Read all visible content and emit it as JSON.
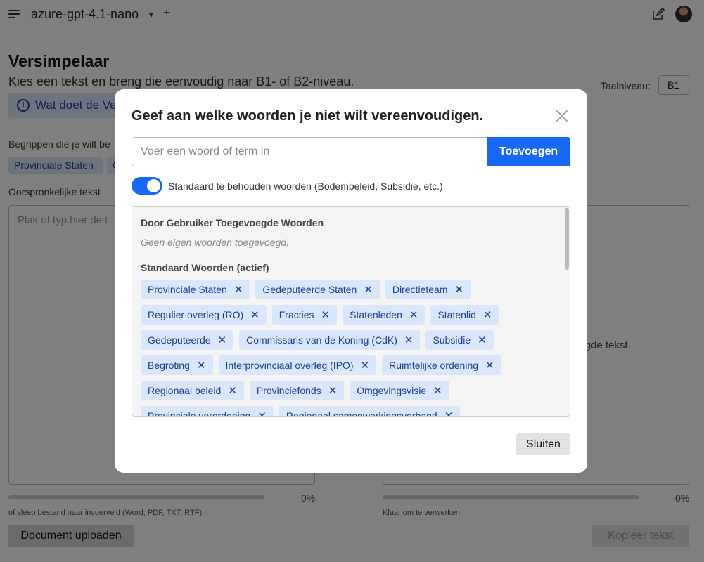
{
  "header": {
    "model_name": "azure-gpt-4.1-nano",
    "chevron_glyph": "⌄",
    "plus_glyph": "+"
  },
  "page": {
    "title": "Versimpelaar",
    "subtitle": "Kies een tekst en breng die eenvoudig naar B1- of B2-niveau.",
    "info_text": "Wat doet de Ve",
    "level_label": "Taalniveau:",
    "level_value": "B1",
    "terms_label": "Begrippen die je wilt be",
    "term_chips": [
      "Provinciale Staten",
      "G"
    ],
    "original_label": "Oorspronkelijke tekst",
    "original_placeholder": "Plak of typ hier de t",
    "result_text": "digde tekst.",
    "left_percent": "0%",
    "right_percent": "0%",
    "left_hint": "of sleep bestand naar invoerveld (Word, PDF, TXT, RTF)",
    "right_hint": "Klaar om te verwerken",
    "upload_button": "Document uploaden",
    "copy_button": "Kopieer tekst"
  },
  "modal": {
    "title": "Geef aan welke woorden je niet wilt vereenvoudigen.",
    "input_placeholder": "Voer een woord of term in",
    "input_value": "",
    "add_button": "Toevoegen",
    "toggle_on": true,
    "toggle_label": "Standaard te behouden woorden (Bodembeleid, Subsidie, etc.)",
    "user_words_heading": "Door Gebruiker Toegevoegde Woorden",
    "user_words_empty": "Geen eigen woorden toegevoegd.",
    "default_words_heading": "Standaard Woorden (actief)",
    "default_words": [
      "Provinciale Staten",
      "Gedeputeerde Staten",
      "Directieteam",
      "Regulier overleg (RO)",
      "Fracties",
      "Statenleden",
      "Statenlid",
      "Gedeputeerde",
      "Commissaris van de Koning (CdK)",
      "Subsidie",
      "Begroting",
      "Interprovinciaal overleg (IPO)",
      "Ruimtelijke ordening",
      "Regionaal beleid",
      "Provinciefonds",
      "Omgevingsvisie",
      "Provinciale verordening",
      "Regionaal samenwerkingsverband"
    ],
    "remove_glyph": "✕",
    "close_button": "Sluiten"
  },
  "icons": {
    "menu": "menu-icon",
    "edit": "edit-icon",
    "info": "info-icon",
    "close": "close-icon",
    "remove": "remove-icon"
  },
  "colors": {
    "primary": "#1668f5",
    "chip_bg": "#d9e6fb",
    "chip_text": "#1c3f94",
    "overlay": "rgba(0,0,0,0.5)"
  }
}
